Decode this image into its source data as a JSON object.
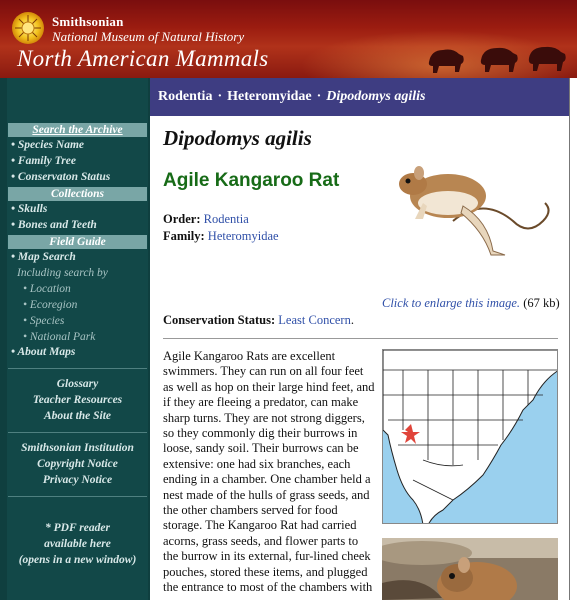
{
  "header": {
    "org": "Smithsonian",
    "museum": "National Museum of Natural History",
    "site_title": "North American Mammals"
  },
  "breadcrumb": {
    "order": "Rodentia",
    "family": "Heteromyidae",
    "species": "Dipodomys agilis",
    "separator": "·"
  },
  "nav": {
    "search_archive": "Search the Archive",
    "search_items": [
      "• Species Name",
      "• Family Tree",
      "• Conservaton Status"
    ],
    "collections_head": "Collections",
    "collections_items": [
      "• Skulls",
      "• Bones and Teeth"
    ],
    "field_guide_head": "Field Guide",
    "map_search": "• Map Search",
    "including": "Including search by",
    "sub_items": [
      "• Location",
      "• Ecoregion",
      "• Species",
      "• National Park"
    ],
    "about_maps": "• About Maps",
    "links1": [
      "Glossary",
      "Teacher Resources",
      "About the Site"
    ],
    "links2": [
      "Smithsonian Institution",
      "Copyright Notice",
      "Privacy Notice"
    ],
    "pdf_note": [
      "* PDF reader",
      "available here",
      "(opens in a new window)"
    ]
  },
  "species": {
    "scientific_name": "Dipodomys agilis",
    "common_name": "Agile Kangaroo Rat",
    "order_label": "Order:",
    "order_value": "Rodentia",
    "family_label": "Family:",
    "family_value": "Heteromyidae",
    "status_label": "Conservation Status:",
    "status_value": "Least Concern",
    "status_end": ".",
    "enlarge_link": "Click to enlarge this image.",
    "enlarge_size": "(67 kb)",
    "description": "Agile Kangaroo Rats are excellent swimmers. They can run on all four feet as well as hop on their large hind feet, and if they are fleeing a predator, can make sharp turns. They are not strong diggers, so they commonly dig their burrows in loose, sandy soil. Their burrows can be extensive: one had six branches, each ending in a chamber. One chamber held a nest made of the hulls of grass seeds, and the other chambers served for food storage. The Kangaroo Rat had carried acorns, grass seeds, and flower parts to the burrow in its external, fur-lined cheek pouches, stored these items, and plugged the entrance to most of the chambers with"
  },
  "colors": {
    "banner": "#9b1c10",
    "nav_bg": "#124848",
    "nav_head": "#79a6a6",
    "breadcrumb_bg": "#3e3d82",
    "common_name": "#176b17",
    "link": "#3050a8",
    "range_marker": "#e0443a"
  }
}
